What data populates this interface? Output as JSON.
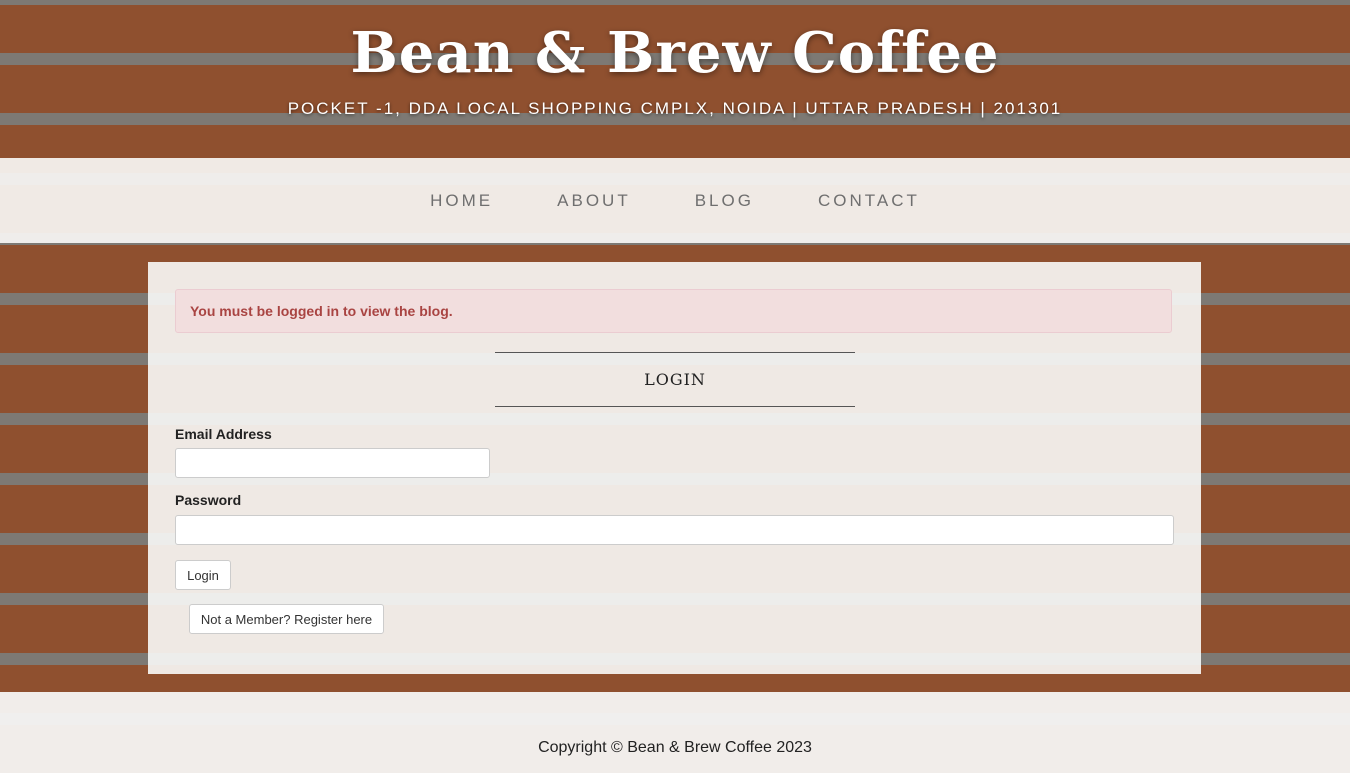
{
  "header": {
    "title": "Bean & Brew Coffee",
    "address": "POCKET -1, DDA LOCAL SHOPPING CMPLX, NOIDA | UTTAR PRADESH | 201301"
  },
  "nav": {
    "items": [
      {
        "label": "HOME"
      },
      {
        "label": "ABOUT"
      },
      {
        "label": "BLOG"
      },
      {
        "label": "CONTACT"
      }
    ]
  },
  "alert": {
    "message": "You must be logged in to view the blog."
  },
  "login": {
    "heading": "LOGIN",
    "email_label": "Email Address",
    "email_value": "",
    "password_label": "Password",
    "password_value": "",
    "submit_label": "Login",
    "register_label": "Not a Member? Register here"
  },
  "footer": {
    "copyright": "Copyright © Bean & Brew Coffee 2023"
  },
  "colors": {
    "alert_background": "#f2dede",
    "alert_text": "#a94442",
    "nav_text": "#6f6f6f"
  }
}
